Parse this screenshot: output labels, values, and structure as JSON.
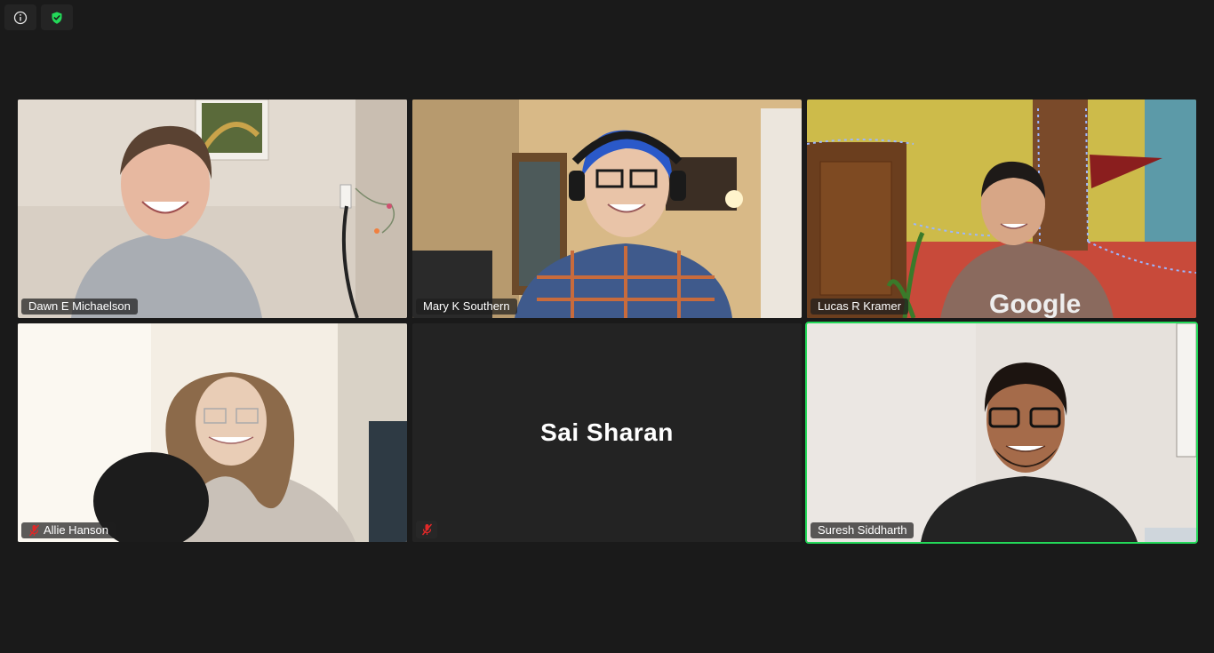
{
  "top_bar": {
    "info_icon": "info-icon",
    "security_icon": "shield-check-icon",
    "security_color": "#23d959"
  },
  "participants": [
    {
      "name": "Dawn E Michaelson",
      "muted": false,
      "video": true
    },
    {
      "name": "Mary K Southern",
      "muted": false,
      "video": true
    },
    {
      "name": "Lucas R Kramer",
      "muted": false,
      "video": true
    },
    {
      "name": "Allie Hanson",
      "muted": true,
      "video": true
    },
    {
      "name": "Sai Sharan",
      "muted": true,
      "video": false
    },
    {
      "name": "Suresh Siddharth",
      "muted": false,
      "video": true,
      "active_speaker": true
    }
  ],
  "colors": {
    "background": "#1a1a1a",
    "active_speaker_border": "#23d959",
    "muted_icon": "#e02828"
  }
}
